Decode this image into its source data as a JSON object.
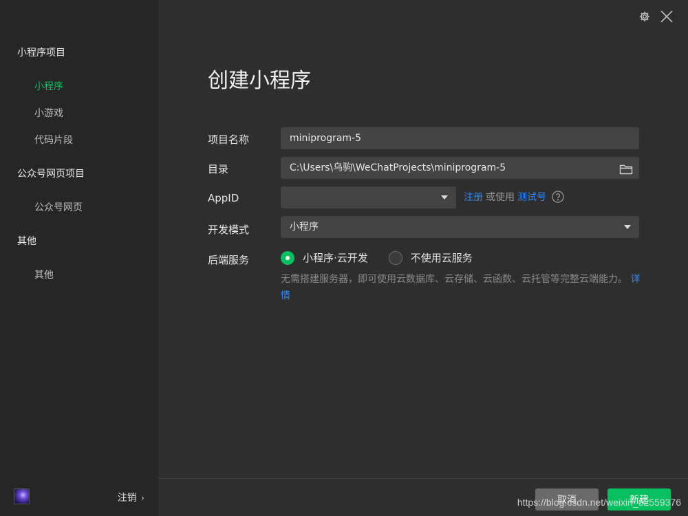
{
  "sidebar": {
    "groups": [
      {
        "title": "小程序项目",
        "items": [
          "小程序",
          "小游戏",
          "代码片段"
        ]
      },
      {
        "title": "公众号网页项目",
        "items": [
          "公众号网页"
        ]
      },
      {
        "title": "其他",
        "items": [
          "其他"
        ]
      }
    ],
    "active_item": "小程序",
    "footer": {
      "logout_label": "注销",
      "chevron": "›"
    }
  },
  "top_icons": [
    "gear-icon",
    "close-icon"
  ],
  "main": {
    "title": "创建小程序",
    "form": {
      "project_name": {
        "label": "项目名称",
        "value": "miniprogram-5"
      },
      "directory": {
        "label": "目录",
        "value": "C:\\Users\\乌驹\\WeChatProjects\\miniprogram-5"
      },
      "appid": {
        "label": "AppID",
        "value": "",
        "links": {
          "register": "注册",
          "or_use": "或使用",
          "test_account": "测试号"
        }
      },
      "dev_mode": {
        "label": "开发模式",
        "value": "小程序"
      },
      "backend": {
        "label": "后端服务",
        "options": [
          "小程序·云开发",
          "不使用云服务"
        ],
        "selected": 0,
        "description": "无需搭建服务器，即可使用云数据库、云存储、云函数、云托管等完整云端能力。",
        "details_link": "详情"
      }
    }
  },
  "bottom": {
    "cancel_label": "取消",
    "create_label": "新建"
  },
  "watermark": "https://blog.csdn.net/weixin_02559376",
  "colors": {
    "accent": "#07c160",
    "link": "#2b8af7",
    "background": "#2e2e2e",
    "sidebar": "#262626"
  }
}
